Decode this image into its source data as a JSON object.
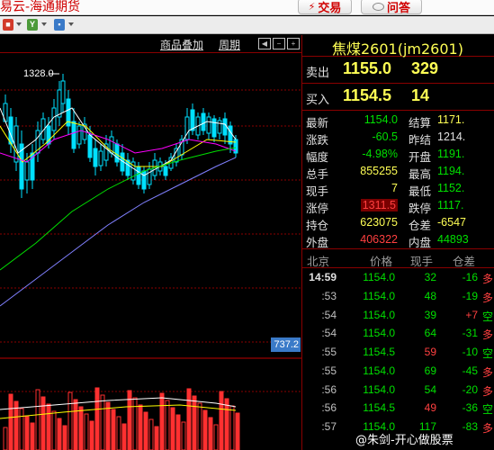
{
  "app": {
    "title": "易云-海通期货"
  },
  "toolbar": {
    "trade_label": "交易",
    "ask_label": "问答",
    "icons": [
      "red-tool-icon",
      "green-y-icon",
      "blue-tool-icon"
    ],
    "icon_y": "Y"
  },
  "chart_header": {
    "overlay_link": "商品叠加",
    "period_link": "周期"
  },
  "chart": {
    "high_label": "1328.0",
    "axis_value": "737.2",
    "colors": {
      "up": "#00e0ff",
      "down": "#00e0ff",
      "ma5": "#ffffff",
      "ma10": "#ffff00",
      "ma20": "#ff00ff",
      "ma60": "#00e000",
      "ma120": "#8080ff",
      "volume": "#ff3030"
    }
  },
  "quote": {
    "name": "焦煤2601(jm2601)",
    "ask_label": "卖出",
    "ask_price": "1155.0",
    "ask_vol": "329",
    "bid_label": "买入",
    "bid_price": "1154.5",
    "bid_vol": "14",
    "stats": [
      {
        "l1": "最新",
        "v1": "1154.0",
        "c1": "green",
        "l2": "结算",
        "v2": "1171.",
        "c2": "yellow"
      },
      {
        "l1": "涨跌",
        "v1": "-60.5",
        "c1": "green",
        "l2": "昨结",
        "v2": "1214.",
        "c2": "white"
      },
      {
        "l1": "幅度",
        "v1": "-4.98%",
        "c1": "green",
        "l2": "开盘",
        "v2": "1191.",
        "c2": "green"
      },
      {
        "l1": "总手",
        "v1": "855255",
        "c1": "yellow",
        "l2": "最高",
        "v2": "1194.",
        "c2": "green"
      },
      {
        "l1": "现手",
        "v1": "7",
        "c1": "yellow",
        "l2": "最低",
        "v2": "1152.",
        "c2": "green"
      },
      {
        "l1": "涨停",
        "v1": "1311.5",
        "c1": "red",
        "l2": "跌停",
        "v2": "1117.",
        "c2": "green"
      },
      {
        "l1": "持仓",
        "v1": "623075",
        "c1": "yellow",
        "l2": "仓差",
        "v2": "-6547",
        "c2": "yellow"
      },
      {
        "l1": "外盘",
        "v1": "406322",
        "c1": "red",
        "l2": "内盘",
        "v2": "44893",
        "c2": "green"
      }
    ],
    "ticks_header": {
      "time": "北京",
      "price": "价格",
      "qty": "现手",
      "diff": "仓差"
    },
    "ticks": [
      {
        "t": "14:59",
        "p": "1154.0",
        "pc": "green",
        "q": "32",
        "qc": "green",
        "d": "-16",
        "k": "多"
      },
      {
        "t": ":53",
        "p": "1154.0",
        "pc": "green",
        "q": "48",
        "qc": "green",
        "d": "-19",
        "k": "多"
      },
      {
        "t": ":54",
        "p": "1154.0",
        "pc": "green",
        "q": "39",
        "qc": "green",
        "d": "+7",
        "k": "空"
      },
      {
        "t": ":54",
        "p": "1154.0",
        "pc": "green",
        "q": "64",
        "qc": "green",
        "d": "-31",
        "k": "多"
      },
      {
        "t": ":55",
        "p": "1154.5",
        "pc": "green",
        "q": "59",
        "qc": "red",
        "d": "-10",
        "k": "空"
      },
      {
        "t": ":55",
        "p": "1154.0",
        "pc": "green",
        "q": "69",
        "qc": "green",
        "d": "-45",
        "k": "多"
      },
      {
        "t": ":56",
        "p": "1154.0",
        "pc": "green",
        "q": "54",
        "qc": "green",
        "d": "-20",
        "k": "多"
      },
      {
        "t": ":56",
        "p": "1154.5",
        "pc": "green",
        "q": "49",
        "qc": "red",
        "d": "-36",
        "k": "空"
      },
      {
        "t": ":57",
        "p": "1154.0",
        "pc": "green",
        "q": "117",
        "qc": "green",
        "d": "-83",
        "k": "多"
      }
    ]
  },
  "watermark": "@朱剑-开心做股票"
}
